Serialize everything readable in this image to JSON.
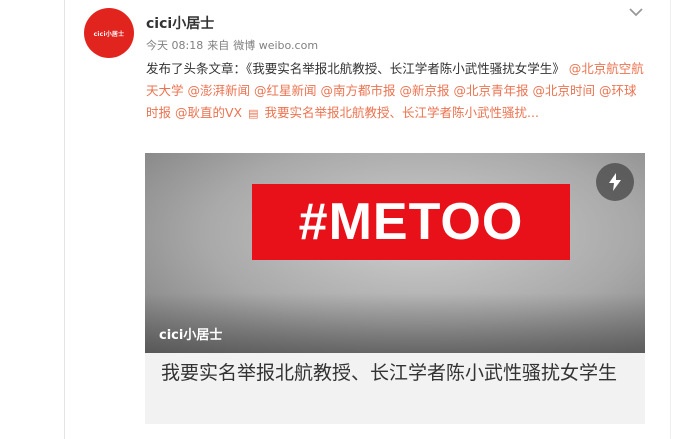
{
  "post": {
    "user": {
      "name": "cici小居士",
      "avatar_text": "cici小居士"
    },
    "meta": {
      "time": "今天 08:18",
      "source_prefix": "来自",
      "source_app": "微博 weibo.com"
    },
    "text": {
      "lead": "发布了头条文章：《我要实名举报北航教授、长江学者陈小武性骚扰女学生》",
      "mentions": [
        "@北京航空航天大学",
        "@澎湃新闻",
        "@红星新闻",
        "@南方都市报",
        "@新京报",
        "@北京青年报",
        "@北京时间",
        "@环球时报",
        "@耿直的VX"
      ],
      "article_icon": "article-icon",
      "link_text": "我要实名举报北航教授、长江学者陈小武性骚扰...",
      "link_color": "#eb7350"
    },
    "card": {
      "banner_text": "#METOO",
      "banner_color": "#e8111a",
      "watermark": "cici小居士",
      "flash_icon": "lightning-icon",
      "title": "我要实名举报北航教授、长江学者陈小武性骚扰女学生"
    },
    "menu_icon": "chevron-down-icon"
  }
}
